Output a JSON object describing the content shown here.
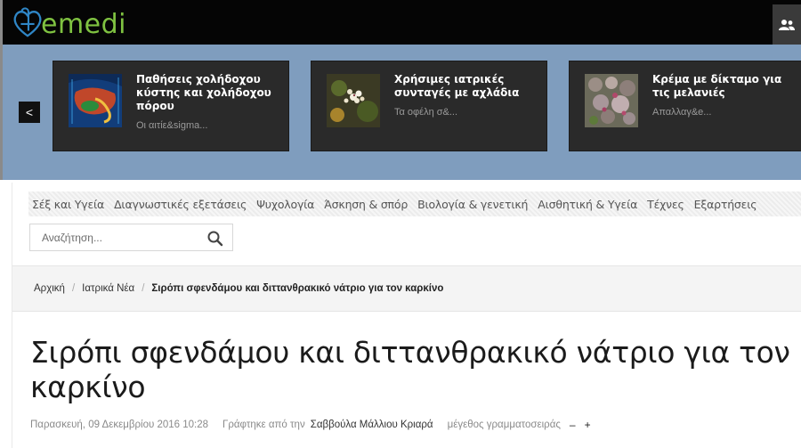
{
  "header": {
    "logo_text": "emedi",
    "logo_color": "#7fc241",
    "user_icon": "users-icon"
  },
  "carousel": {
    "prev_icon": "chevron-left-icon",
    "prev_label": "<",
    "cards": [
      {
        "title": "Παθήσεις χολήδοχου κύστης και χολήδοχου πόρου",
        "excerpt": "Οι αιτίε&sigma..."
      },
      {
        "title": "Χρήσιμες ιατρικές συνταγές με αχλάδια",
        "excerpt": "Τα οφέλη σ&..."
      },
      {
        "title": "Κρέμα με δίκταμο για τις μελανιές",
        "excerpt": "Απαλλαγ&e..."
      }
    ]
  },
  "nav": {
    "items": [
      "Σέξ και Υγεία",
      "Διαγνωστικές εξετάσεις",
      "Ψυχολογία",
      "Άσκηση & σπόρ",
      "Βιολογία & γενετική",
      "Αισθητική & Υγεία",
      "Τέχνες",
      "Εξαρτήσεις"
    ]
  },
  "search": {
    "placeholder": "Αναζήτηση...",
    "icon": "search-icon"
  },
  "breadcrumb": {
    "home": "Αρχική",
    "section": "Ιατρικά Νέα",
    "current": "Σιρόπι σφενδάμου και διττανθρακικό νάτριο για τον καρκίνο",
    "separator": "/"
  },
  "article": {
    "title": "Σιρόπι σφενδάμου και διττανθρακικό νάτριο για τον καρκίνο",
    "date": "Παρασκευή, 09 Δεκεμβρίου 2016 10:28",
    "written_by": "Γράφτηκε από την",
    "author": "Σαββούλα Μάλλιου Κριαρά",
    "font_size_label": "μέγεθος γραμματοσειράς",
    "font_decrease": "–",
    "font_increase": "+"
  }
}
